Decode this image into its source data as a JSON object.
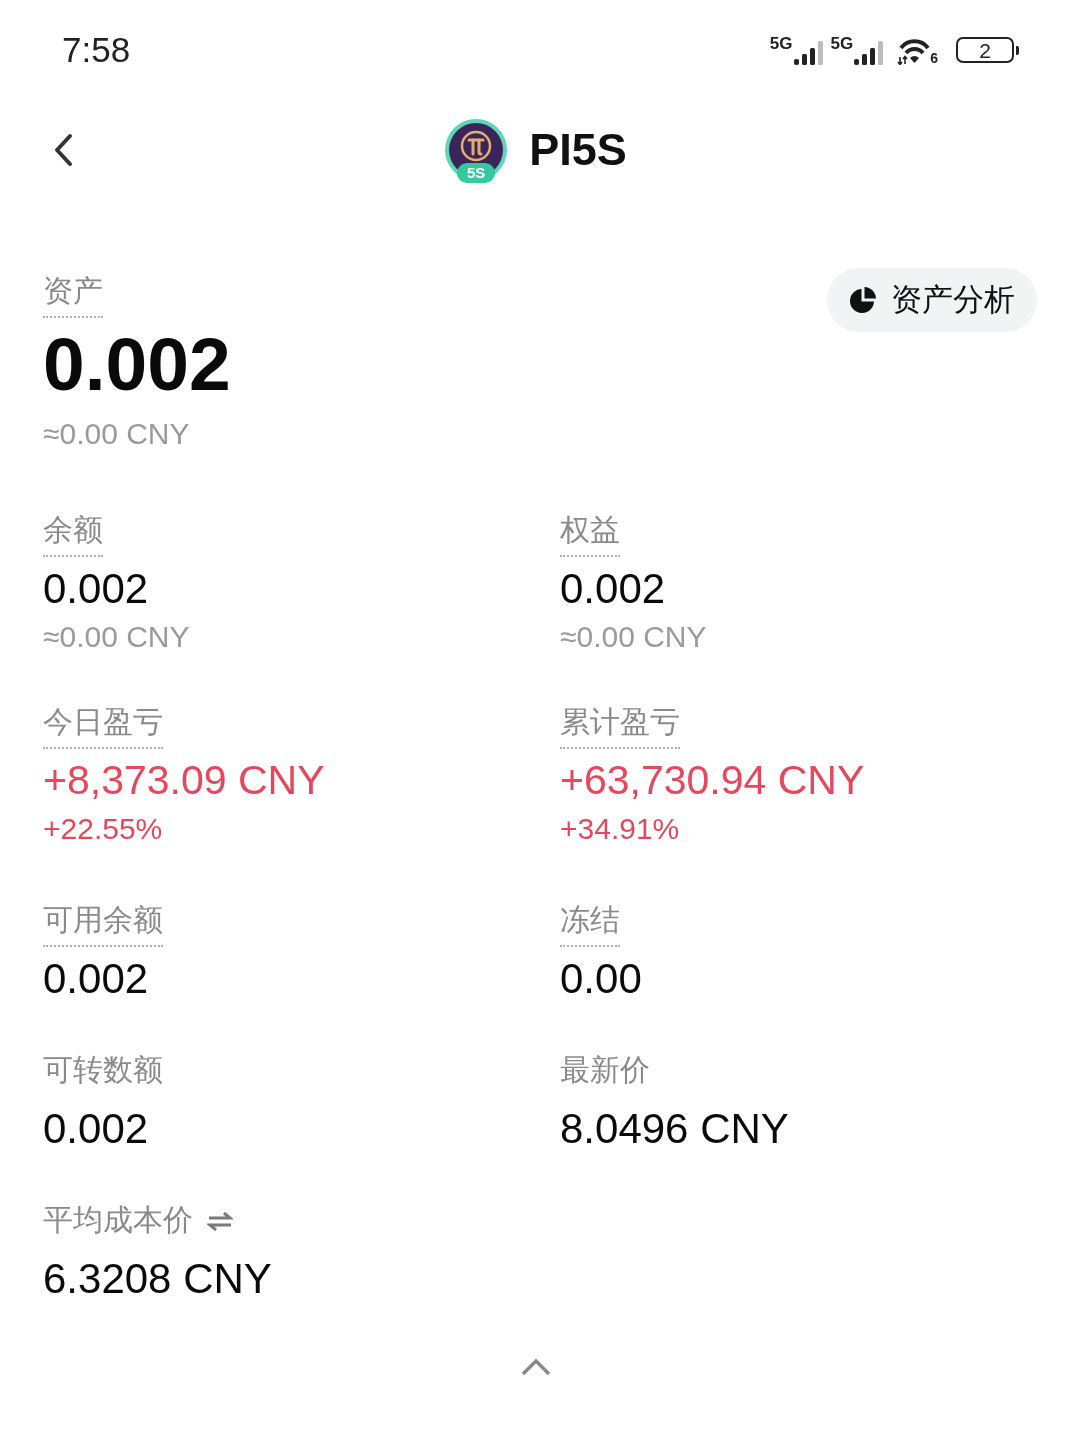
{
  "status_bar": {
    "time": "7:58",
    "networks": [
      {
        "type": "5G"
      },
      {
        "type": "5G"
      }
    ],
    "wifi_standard": "6",
    "battery": "2"
  },
  "header": {
    "title": "PI5S",
    "logo_badge": "5S"
  },
  "asset": {
    "label": "资产",
    "underlined": true,
    "value": "0.002",
    "approx": "≈0.00 CNY"
  },
  "analysis_button": {
    "label": "资产分析"
  },
  "stats": [
    {
      "kind": "amount",
      "label": "余额",
      "underlined": true,
      "switchable": false,
      "value": "0.002",
      "approx": "≈0.00 CNY"
    },
    {
      "kind": "amount",
      "label": "权益",
      "underlined": true,
      "switchable": false,
      "value": "0.002",
      "approx": "≈0.00 CNY"
    },
    {
      "kind": "pnl",
      "label": "今日盈亏",
      "underlined": true,
      "switchable": false,
      "value": "+8,373.09 CNY",
      "percent": "+22.55%"
    },
    {
      "kind": "pnl",
      "label": "累计盈亏",
      "underlined": true,
      "switchable": false,
      "value": "+63,730.94 CNY",
      "percent": "+34.91%"
    },
    {
      "kind": "amount",
      "label": "可用余额",
      "underlined": true,
      "switchable": false,
      "value": "0.002"
    },
    {
      "kind": "amount",
      "label": "冻结",
      "underlined": true,
      "switchable": false,
      "value": "0.00"
    },
    {
      "kind": "amount",
      "label": "可转数额",
      "underlined": false,
      "switchable": false,
      "value": "0.002"
    },
    {
      "kind": "amount",
      "label": "最新价",
      "underlined": false,
      "switchable": false,
      "value": "8.0496 CNY"
    },
    {
      "kind": "amount",
      "label": "平均成本价",
      "underlined": false,
      "switchable": true,
      "value": "6.3208 CNY"
    }
  ]
}
